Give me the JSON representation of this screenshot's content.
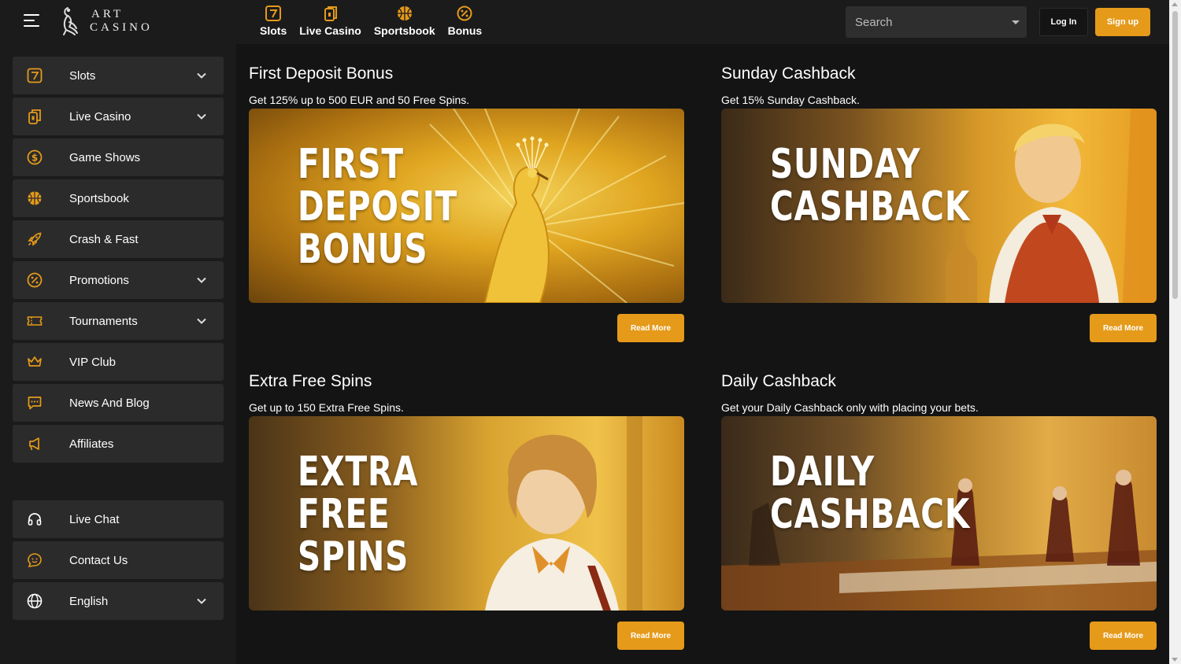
{
  "brand": {
    "line1": "ART",
    "line2": "CASINO"
  },
  "topnav": [
    {
      "label": "Slots",
      "icon": "slot-seven-icon"
    },
    {
      "label": "Live Casino",
      "icon": "cards-icon"
    },
    {
      "label": "Sportsbook",
      "icon": "basketball-icon"
    },
    {
      "label": "Bonus",
      "icon": "percent-icon"
    }
  ],
  "search": {
    "placeholder": "Search"
  },
  "auth": {
    "login_label": "Log In",
    "signup_label": "Sign up"
  },
  "sidebar": {
    "items": [
      {
        "label": "Slots",
        "icon": "slot-seven-icon",
        "has_dropdown": true
      },
      {
        "label": "Live Casino",
        "icon": "cards-icon",
        "has_dropdown": true
      },
      {
        "label": "Game Shows",
        "icon": "dollar-coin-icon",
        "has_dropdown": false
      },
      {
        "label": "Sportsbook",
        "icon": "basketball-icon",
        "has_dropdown": false
      },
      {
        "label": "Crash & Fast",
        "icon": "rocket-icon",
        "has_dropdown": false
      },
      {
        "label": "Promotions",
        "icon": "percent-icon",
        "has_dropdown": true
      },
      {
        "label": "Tournaments",
        "icon": "ticket-icon",
        "has_dropdown": true
      },
      {
        "label": "VIP Club",
        "icon": "crown-icon",
        "has_dropdown": false
      },
      {
        "label": "News And Blog",
        "icon": "chat-bubble-icon",
        "has_dropdown": false
      },
      {
        "label": "Affiliates",
        "icon": "megaphone-icon",
        "has_dropdown": false
      }
    ],
    "bottom_items": [
      {
        "label": "Live Chat",
        "icon": "headset-icon",
        "has_dropdown": false
      },
      {
        "label": "Contact Us",
        "icon": "smile-chat-icon",
        "has_dropdown": false
      },
      {
        "label": "English",
        "icon": "globe-icon",
        "has_dropdown": true
      }
    ]
  },
  "promotions": [
    {
      "title": "First Deposit Bonus",
      "description": "Get 125% up to 500 EUR and 50 Free Spins.",
      "banner_text": "FIRST\nDEPOSIT\nBONUS",
      "cta": "Read More"
    },
    {
      "title": "Sunday Cashback",
      "description": "Get 15% Sunday Cashback.",
      "banner_text": "SUNDAY\nCASHBACK",
      "cta": "Read More"
    },
    {
      "title": "Extra Free Spins",
      "description": "Get up to 150 Extra Free Spins.",
      "banner_text": "EXTRA\nFREE\nSPINS",
      "cta": "Read More"
    },
    {
      "title": "Daily Cashback",
      "description": "Get your Daily Cashback only with placing your bets.",
      "banner_text": "DAILY\nCASHBACK",
      "cta": "Read More"
    }
  ],
  "colors": {
    "accent": "#e59a1a",
    "sidebar_item_bg": "#2b2b2b",
    "header_bg": "#1b1b1b",
    "page_bg": "#141414"
  }
}
